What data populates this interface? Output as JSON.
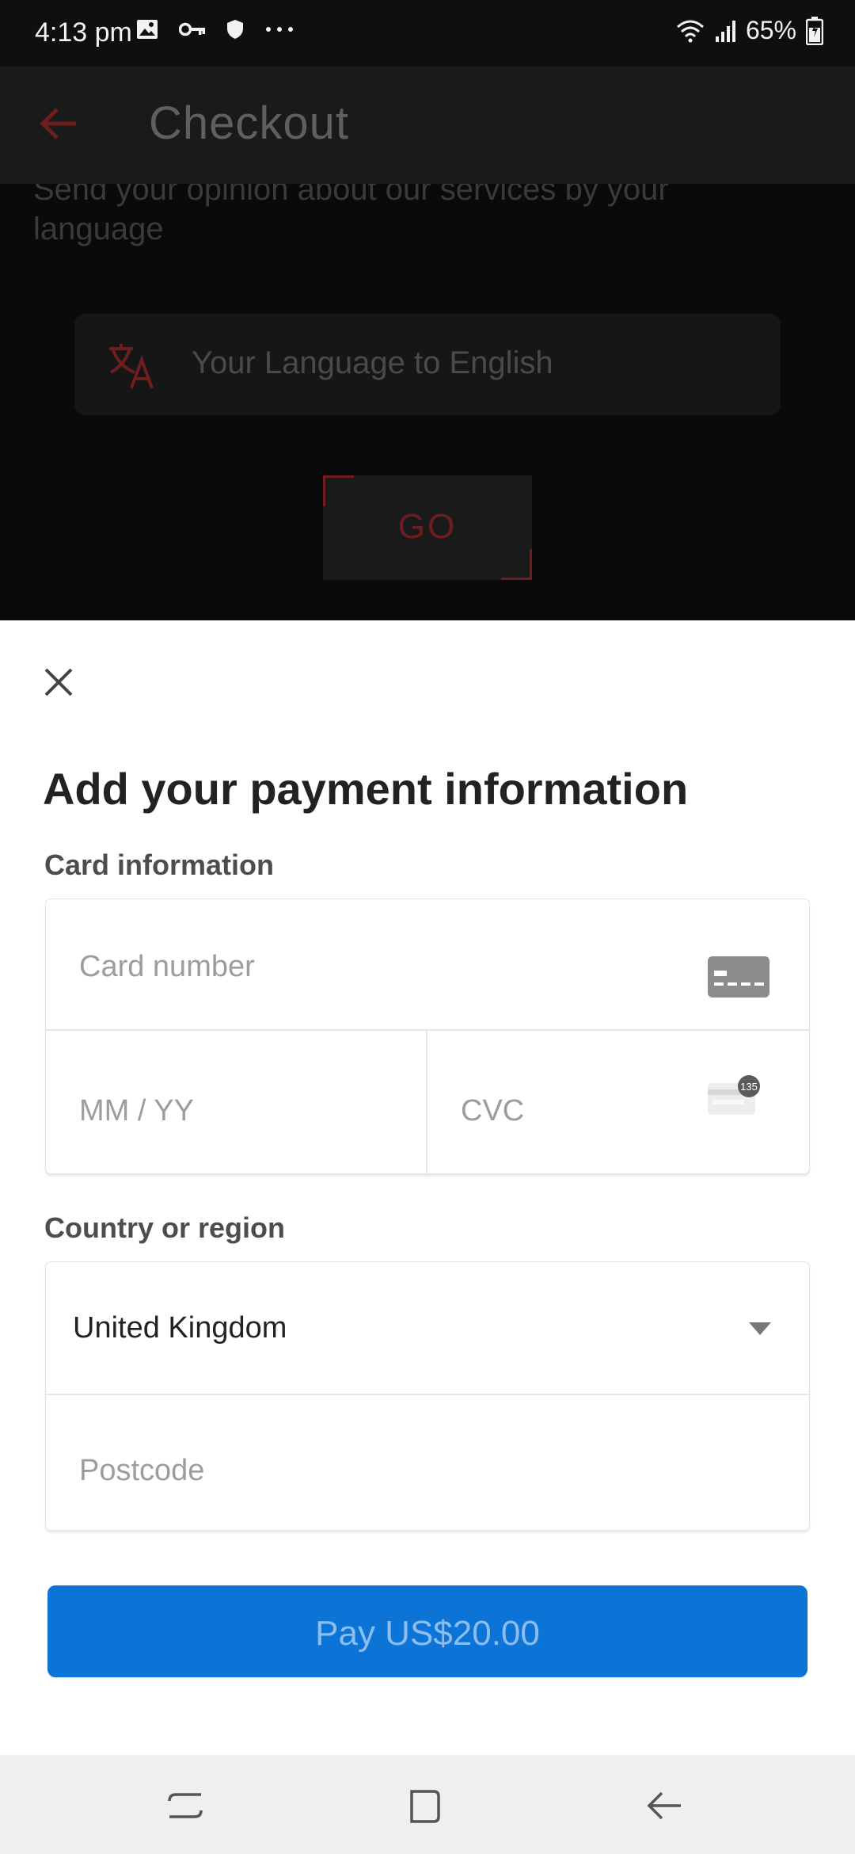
{
  "status_bar": {
    "time": "4:13 pm",
    "icons": [
      "image-icon",
      "key-icon",
      "shield-icon",
      "more-dots-icon"
    ],
    "battery": "65%"
  },
  "background_app": {
    "title": "Checkout",
    "opinion_text": "Send your opinion about our services by your language",
    "language_field": "Your Language to English",
    "go_button": "GO",
    "accent_color": "#6e1e1e"
  },
  "payment_sheet": {
    "title": "Add your payment information",
    "card_section_label": "Card information",
    "card_number_placeholder": "Card number",
    "expiry_placeholder": "MM / YY",
    "cvc_placeholder": "CVC",
    "cvc_badge": "135",
    "country_section_label": "Country or region",
    "country_value": "United Kingdom",
    "postcode_placeholder": "Postcode",
    "pay_button": "Pay US$20.00",
    "pay_color": "#0b74d6"
  },
  "nav_bar": {
    "buttons": [
      "recents-icon",
      "home-icon",
      "back-icon"
    ]
  }
}
